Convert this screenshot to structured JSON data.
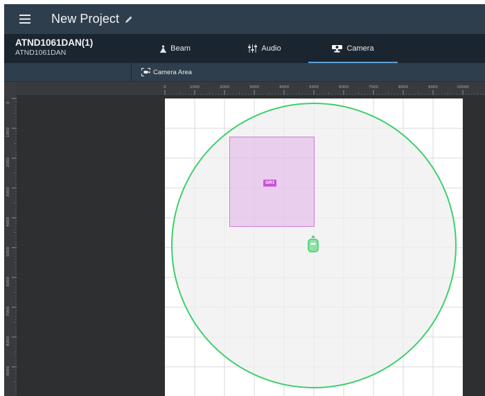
{
  "header": {
    "project_title": "New Project",
    "menu_icon": "hamburger-menu-icon",
    "edit_icon": "pencil-icon",
    "bg_color": "#2f3e4d"
  },
  "device": {
    "name": "ATND1061DAN(1)",
    "model": "ATND1061DAN"
  },
  "tabs": [
    {
      "label": "Beam",
      "icon": "beam-icon",
      "active": false
    },
    {
      "label": "Audio",
      "icon": "mixer-sliders-icon",
      "active": false
    },
    {
      "label": "Camera",
      "icon": "camera-icon",
      "active": true
    }
  ],
  "toolbar": {
    "camera_area_label": "Camera Area",
    "camera_area_icon": "camera-area-icon"
  },
  "ruler": {
    "x_labels": [
      "0",
      "1000",
      "2000",
      "3000",
      "4000",
      "5000",
      "6000",
      "7000",
      "8000",
      "9000",
      "10000"
    ],
    "y_labels": [
      "0",
      "1000",
      "2000",
      "3000",
      "4000",
      "5000",
      "6000",
      "7000",
      "8000",
      "9000"
    ]
  },
  "canvas": {
    "coverage_circle_color": "#3ecf6c",
    "coverage_fill_color": "#eeeeee",
    "grid_color": "#d9d9d9"
  },
  "group": {
    "label": "GR1",
    "color": "#c854d6"
  },
  "mic": {
    "icon": "microphone-device-icon",
    "color": "#3ecf6c"
  }
}
